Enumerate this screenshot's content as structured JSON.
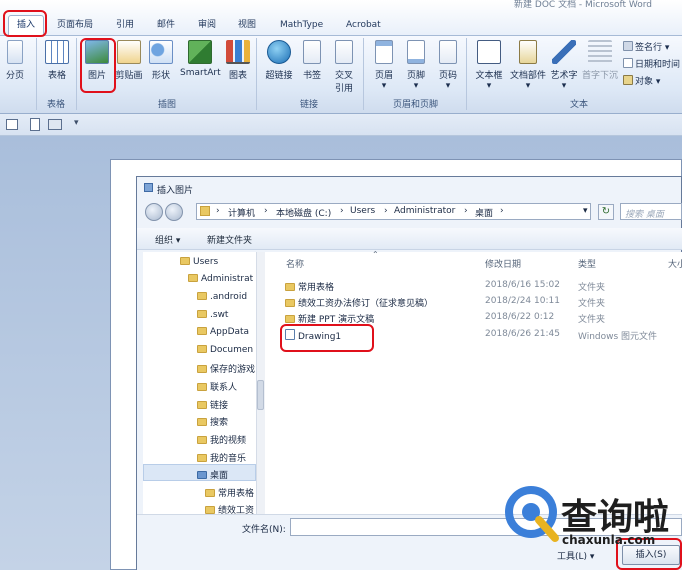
{
  "window": {
    "title": "新建 DOC 文档 - Microsoft Word"
  },
  "tabs": [
    "插入",
    "页面布局",
    "引用",
    "邮件",
    "审阅",
    "视图",
    "MathType",
    "Acrobat"
  ],
  "ribbon": {
    "buttons": [
      {
        "label": "分页",
        "icon": "page-break-icon"
      },
      {
        "label": "表格",
        "icon": "table-icon"
      },
      {
        "label": "图片",
        "icon": "picture-icon"
      },
      {
        "label": "剪贴画",
        "icon": "clipart-icon"
      },
      {
        "label": "形状",
        "icon": "shapes-icon"
      },
      {
        "label": "SmartArt",
        "icon": "smartart-icon"
      },
      {
        "label": "图表",
        "icon": "chart-icon"
      },
      {
        "label": "超链接",
        "icon": "hyperlink-icon"
      },
      {
        "label": "书签",
        "icon": "bookmark-icon"
      },
      {
        "label": "交叉",
        "label2": "引用",
        "icon": "cross-reference-icon"
      },
      {
        "label": "页眉",
        "icon": "header-icon"
      },
      {
        "label": "页脚",
        "icon": "footer-icon"
      },
      {
        "label": "页码",
        "icon": "page-number-icon"
      },
      {
        "label": "文本框",
        "icon": "textbox-icon"
      },
      {
        "label": "文档部件",
        "icon": "quick-parts-icon"
      },
      {
        "label": "艺术字",
        "icon": "wordart-icon"
      },
      {
        "label": "首字下沉",
        "icon": "drop-cap-icon"
      }
    ],
    "small_buttons": [
      "签名行",
      "日期和时间",
      "对象"
    ],
    "groups": [
      "表格",
      "插图",
      "链接",
      "页眉和页脚",
      "文本"
    ]
  },
  "dialog": {
    "title": "插入图片",
    "breadcrumb": [
      "计算机",
      "本地磁盘 (C:)",
      "Users",
      "Administrator",
      "桌面"
    ],
    "search_placeholder": "搜索 桌面",
    "toolbar": {
      "organize": "组织",
      "new_folder": "新建文件夹"
    },
    "nav_items": [
      "Users",
      "Administrat",
      "android",
      "swt",
      "AppData",
      "Documen",
      "保存的游戏",
      "联系人",
      "链接",
      "搜索",
      "我的视频",
      "我的音乐",
      "桌面",
      "常用表格",
      "绩效工资"
    ],
    "columns": [
      "名称",
      "修改日期",
      "类型",
      "大小"
    ],
    "files": [
      {
        "name": "常用表格",
        "date": "2018/6/16 15:02",
        "type": "文件夹"
      },
      {
        "name": "绩效工资办法修订（征求意见稿）",
        "date": "2018/2/24 10:11",
        "type": "文件夹"
      },
      {
        "name": "新建 PPT 演示文稿",
        "date": "2018/6/22 0:12",
        "type": "文件夹"
      },
      {
        "name": "Drawing1",
        "date": "2018/6/26 21:45",
        "type": "Windows 图元文件"
      }
    ],
    "filename_label": "文件名(N):",
    "tools_label": "工具(L)",
    "insert_label": "插入(S)"
  },
  "watermark": {
    "text": "查询啦",
    "url": "chaxunla.com"
  },
  "colors": {
    "highlight": "#e0101b",
    "accent": "#3b7fd9",
    "ribbon": "#dde8f6"
  }
}
